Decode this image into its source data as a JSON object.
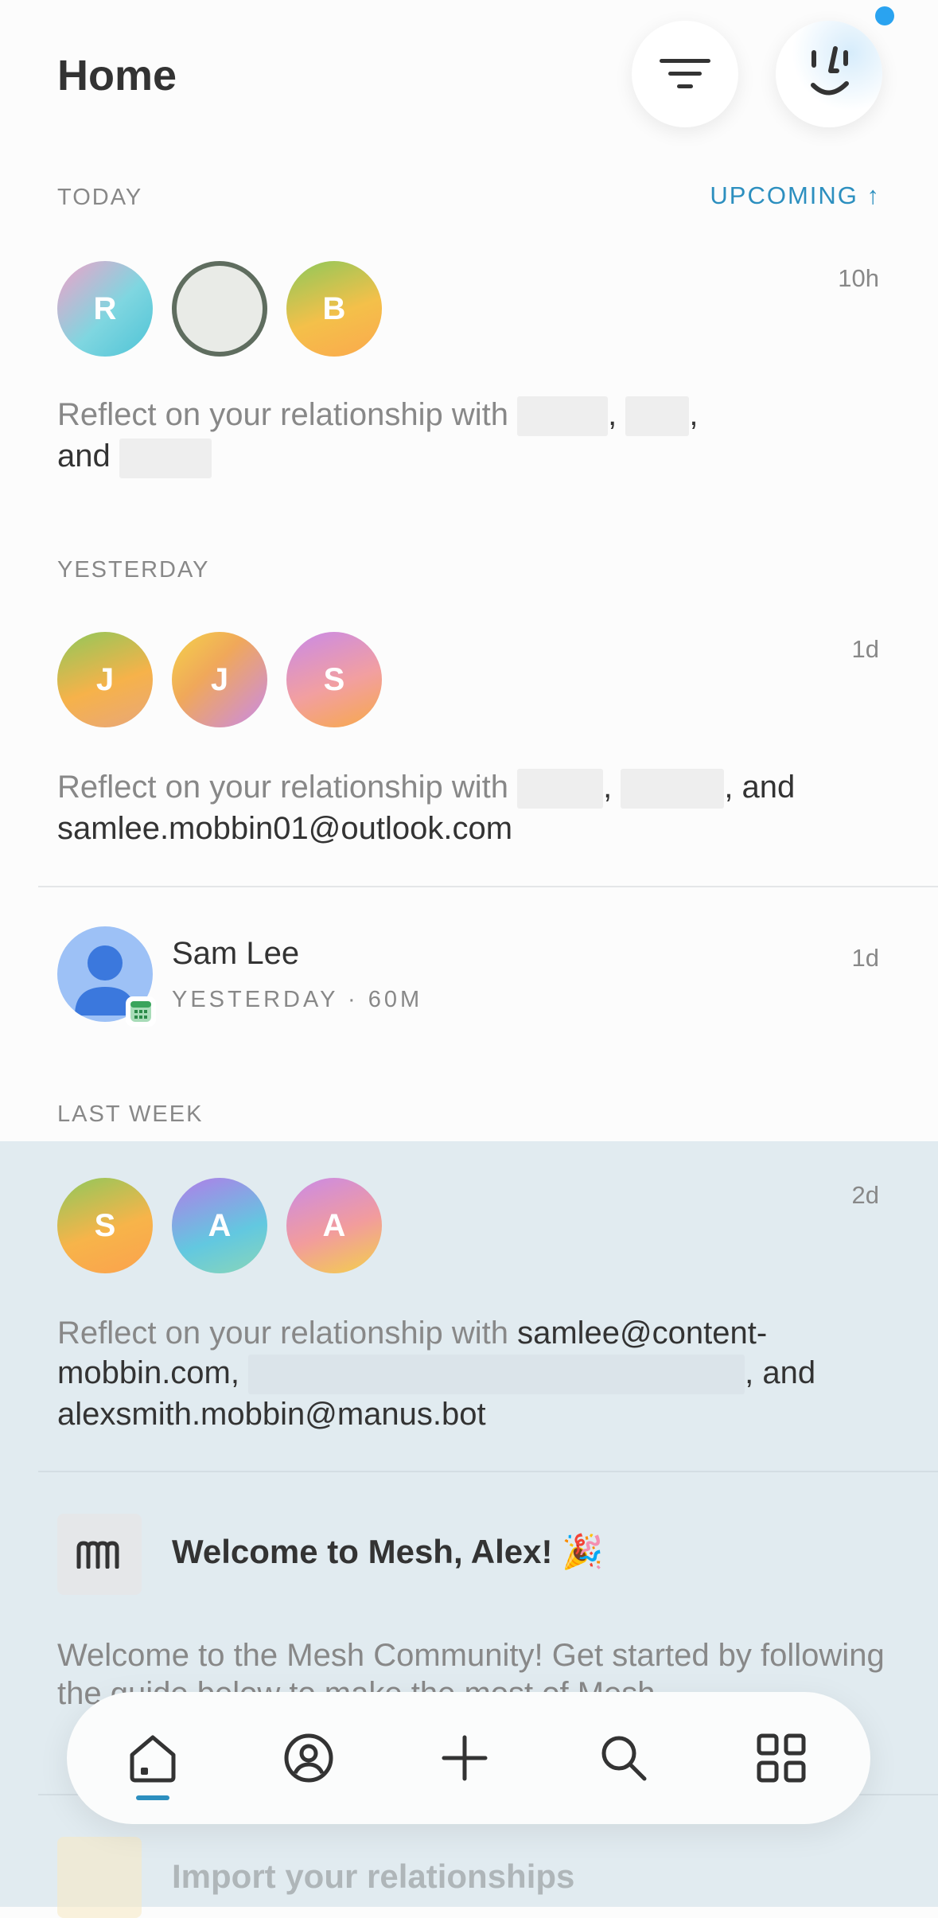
{
  "header": {
    "title": "Home"
  },
  "sections": {
    "today": "TODAY",
    "upcoming": "UPCOMING ↑",
    "yesterday": "YESTERDAY",
    "last_week": "LAST WEEK"
  },
  "feed": {
    "item1": {
      "time": "10h",
      "avatars": [
        "R",
        "",
        "B"
      ],
      "text": "Reflect on your relationship with",
      "sep1": ",",
      "sep2": ",",
      "and": "and"
    },
    "item2": {
      "time": "1d",
      "avatars": [
        "J",
        "J",
        "S"
      ],
      "text": "Reflect on your relationship with",
      "sep1": ",",
      "and": ", and",
      "email": "samlee.mobbin01@outlook.com"
    },
    "item3": {
      "name": "Sam Lee",
      "meta": "YESTERDAY · 60M",
      "time": "1d"
    },
    "item4": {
      "time": "2d",
      "avatars": [
        "S",
        "A",
        "A"
      ],
      "text": "Reflect on your relationship with",
      "email1": "samlee@content-mobbin.com,",
      "and": ", and",
      "email2": "alexsmith.mobbin@manus.bot"
    },
    "item5": {
      "title": "Welcome to Mesh, Alex! 🎉",
      "body": "Welcome to the Mesh Community! Get started by following the guide below to make the most of Mesh.",
      "next_title": "Import your relationships"
    }
  },
  "colors": {
    "accent": "#2c8fbf",
    "notification": "#2aa3f0",
    "highlight_bg": "#e1ebf0"
  },
  "nav": {
    "items": [
      "home-icon",
      "contacts-icon",
      "add-icon",
      "search-icon",
      "apps-icon"
    ],
    "active": "home-icon"
  }
}
